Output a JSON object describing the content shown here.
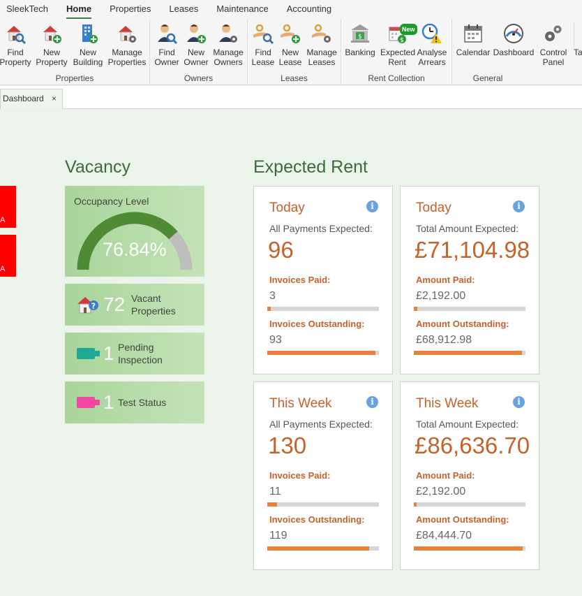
{
  "menu": {
    "app": "SleekTech",
    "items": [
      "Home",
      "Properties",
      "Leases",
      "Maintenance",
      "Accounting"
    ]
  },
  "ribbon": {
    "groups": [
      {
        "label": "Properties",
        "buttons": [
          [
            "Find",
            "Property"
          ],
          [
            "New",
            "Property"
          ],
          [
            "New",
            "Building"
          ],
          [
            "Manage",
            "Properties"
          ]
        ]
      },
      {
        "label": "Owners",
        "buttons": [
          [
            "Find",
            "Owner"
          ],
          [
            "New",
            "Owner"
          ],
          [
            "Manage",
            "Owners"
          ]
        ]
      },
      {
        "label": "Leases",
        "buttons": [
          [
            "Find",
            "Lease"
          ],
          [
            "New",
            "Lease"
          ],
          [
            "Manage",
            "Leases"
          ]
        ]
      },
      {
        "label": "Rent Collection",
        "buttons": [
          [
            "Banking",
            ""
          ],
          [
            "Expected",
            "Rent"
          ],
          [
            "Analyse",
            "Arrears"
          ]
        ]
      },
      {
        "label": "General",
        "buttons": [
          [
            "Calendar",
            ""
          ],
          [
            "Dashboard",
            ""
          ],
          [
            "Control",
            "Panel"
          ],
          [
            "Ta",
            ""
          ]
        ]
      }
    ],
    "new_badge": "New"
  },
  "tabs": {
    "active": "Dashboard",
    "close": "×"
  },
  "left_tiles": [
    "A",
    "A"
  ],
  "vacancy": {
    "heading": "Vacancy",
    "occupancy_label": "Occupancy Level",
    "occupancy_value": "76.84%",
    "occupancy_fraction": 0.7684,
    "vacant_count": "72",
    "vacant_label_1": "Vacant",
    "vacant_label_2": "Properties",
    "pending_count": "1",
    "pending_label_1": "Pending",
    "pending_label_2": "Inspection",
    "test_count": "1",
    "test_label": "Test Status",
    "colors": {
      "gauge_fill": "#4f8a35",
      "gauge_track": "#bdbdbd",
      "pending": "#1fa896",
      "test": "#f0489f"
    }
  },
  "expected_rent": {
    "heading": "Expected Rent",
    "info": "i",
    "cards": [
      {
        "period": "Today",
        "subtitle": "All Payments Expected:",
        "big": "96",
        "paid_label": "Invoices Paid:",
        "paid_value": "3",
        "paid_fraction": 0.03,
        "out_label": "Invoices Outstanding:",
        "out_value": "93",
        "out_fraction": 0.97
      },
      {
        "period": "Today",
        "subtitle": "Total Amount Expected:",
        "big": "£71,104.98",
        "paid_label": "Amount Paid:",
        "paid_value": "£2,192.00",
        "paid_fraction": 0.03,
        "out_label": "Amount Outstanding:",
        "out_value": "£68,912.98",
        "out_fraction": 0.97
      },
      {
        "period": "This Week",
        "subtitle": "All Payments Expected:",
        "big": "130",
        "paid_label": "Invoices Paid:",
        "paid_value": "11",
        "paid_fraction": 0.085,
        "out_label": "Invoices Outstanding:",
        "out_value": "119",
        "out_fraction": 0.915
      },
      {
        "period": "This Week",
        "subtitle": "Total Amount Expected:",
        "big": "£86,636.70",
        "paid_label": "Amount Paid:",
        "paid_value": "£2,192.00",
        "paid_fraction": 0.025,
        "out_label": "Amount Outstanding:",
        "out_value": "£84,444.70",
        "out_fraction": 0.975
      }
    ]
  }
}
